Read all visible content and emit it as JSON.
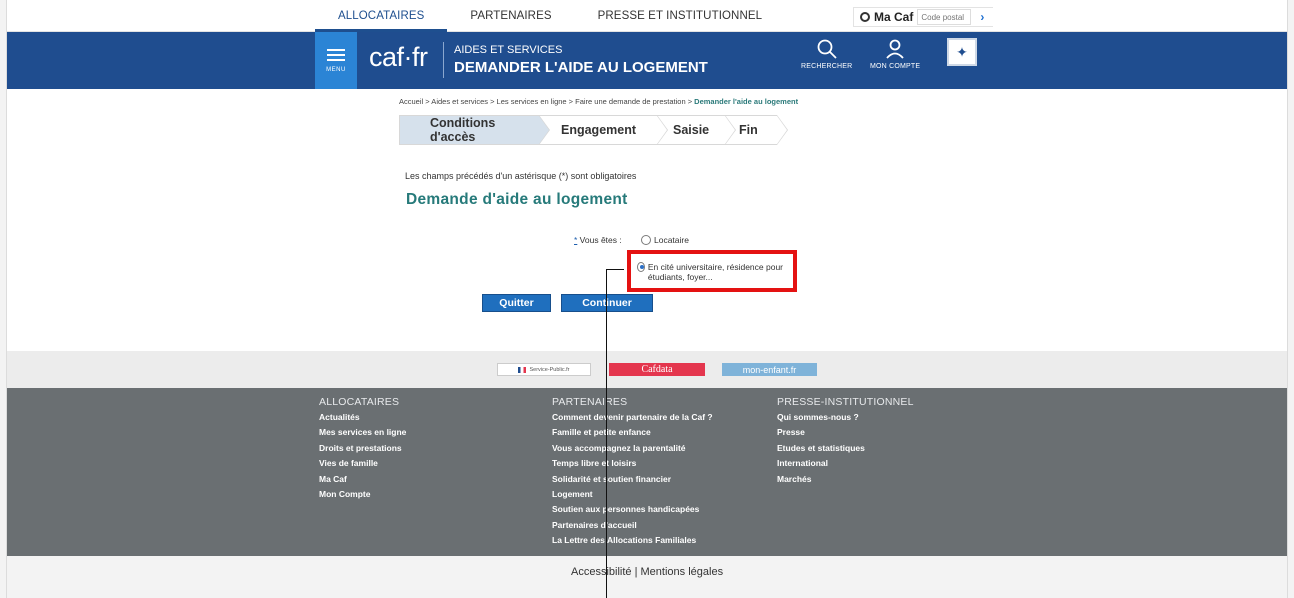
{
  "topnav": {
    "tabs": [
      "ALLOCATAIRES",
      "PARTENAIRES",
      "PRESSE ET INSTITUTIONNEL"
    ],
    "active_tab": "ALLOCATAIRES",
    "macaf_label": "Ma Caf",
    "postal_placeholder": "Code postal",
    "go_glyph": "›"
  },
  "header": {
    "menu_label": "MENU",
    "logo": "caf·fr",
    "section_small": "AIDES ET SERVICES",
    "section_big": "DEMANDER L'AIDE AU LOGEMENT",
    "search_label": "RECHERCHER",
    "account_label": "MON COMPTE",
    "brand_color": "#1f4d8f"
  },
  "breadcrumb": {
    "path": "Accueil > Aides et services > Les services en ligne > Faire une demande de prestation > ",
    "current": "Demander l'aide au logement"
  },
  "steps": [
    "Conditions d'accès",
    "Engagement",
    "Saisie",
    "Fin"
  ],
  "form": {
    "required_note": "Les champs précédés d'un astérisque (*) sont obligatoires",
    "title": "Demande d'aide au logement",
    "question_star": "*",
    "question": " Vous êtes : ",
    "options": [
      {
        "label": "Locataire",
        "checked": false
      },
      {
        "label": "En cité universitaire, résidence pour étudiants, foyer...",
        "checked": true
      }
    ],
    "quit_label": "Quitter",
    "continue_label": "Continuer"
  },
  "partners": {
    "service_public": "Service-Public.fr",
    "cafdata": "Cafdata",
    "monenfant": "mon-enfant.fr"
  },
  "footer": {
    "columns": [
      {
        "heading": "ALLOCATAIRES",
        "items": [
          "Actualités",
          "Mes services en ligne",
          "Droits et prestations",
          "Vies de famille",
          "Ma Caf",
          "Mon Compte"
        ]
      },
      {
        "heading": "PARTENAIRES",
        "items": [
          "Comment devenir partenaire de la Caf ?",
          "Famille et petite enfance",
          "Vous accompagnez la parentalité",
          "Temps libre et loisirs",
          "Solidarité et soutien financier",
          "Logement",
          "Soutien aux personnes handicapées",
          "Partenaires d'accueil",
          "La Lettre des Allocations Familiales"
        ]
      },
      {
        "heading": "PRESSE-INSTITUTIONNEL",
        "items": [
          "Qui sommes-nous ?",
          "Presse",
          "Etudes et statistiques",
          "International",
          "Marchés"
        ]
      }
    ],
    "legal_links": [
      "Accessibilité",
      "Mentions légales"
    ],
    "legal_sep": "|"
  }
}
